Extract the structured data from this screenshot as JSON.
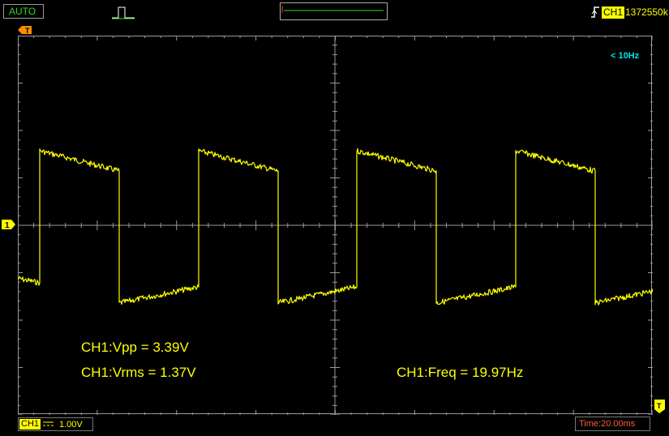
{
  "toolbar": {
    "mode": "AUTO",
    "pulse_icon": "pulse-icon",
    "trigger_edge_icon": "rising-edge-icon",
    "trigger_channel": "CH1",
    "trigger_value": "1372550k"
  },
  "markers": {
    "trigger_top": "T",
    "channel": "1",
    "trigger_right": "T"
  },
  "display": {
    "freq_note": "< 10Hz",
    "trace_color": "#ffff00",
    "grid_color": "#9a9a9a"
  },
  "measurements": {
    "vpp": "CH1:Vpp = 3.39V",
    "vrms": "CH1:Vrms = 1.37V",
    "freq": "CH1:Freq = 19.97Hz"
  },
  "bottom": {
    "channel": "CH1",
    "coupling_icon": "dc-coupling-icon",
    "volts_div": "1.00V",
    "time_div": "Time:20.00ms"
  }
}
